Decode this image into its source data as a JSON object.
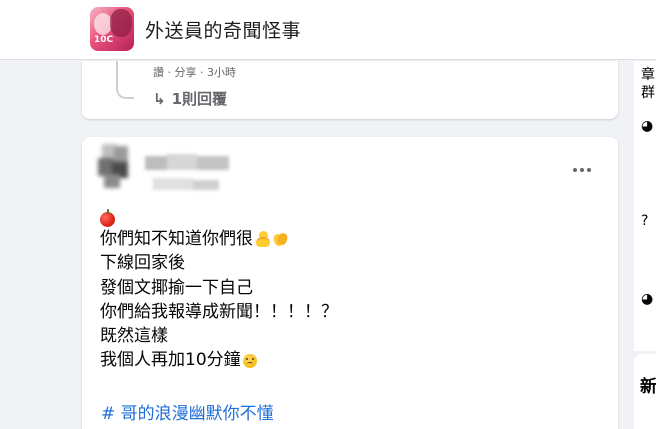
{
  "header": {
    "group_name": "外送員的奇聞怪事",
    "avatar_mark": "10C"
  },
  "previous_comment": {
    "meta": "讚 · 分享 · 3小時",
    "reply_arrow": "↳",
    "reply_label": "1則回覆"
  },
  "post": {
    "more_icon": "more-horizontal-icon",
    "lines": [
      "你們知不知道你們很",
      "下線回家後",
      "發個文揶揄一下自己",
      "你們給我報導成新聞！！！！？",
      "既然這樣",
      "我個人再加10分鐘"
    ],
    "emoji": {
      "line0": "apple-icon",
      "line1_end": [
        "baby-chick-icon",
        "clapping-hands-icon"
      ],
      "line6_end": "frowning-face-icon"
    },
    "hashtag": "# 哥的浪漫幽默你不懂"
  },
  "sidebar": {
    "glyphs": [
      "章",
      "群",
      "◕",
      "?",
      "◕"
    ],
    "card2_glyph": "新"
  },
  "colors": {
    "page_bg": "#f0f2f5",
    "card_bg": "#ffffff",
    "hashtag": "#216fdb",
    "meta_text": "#65676b"
  }
}
